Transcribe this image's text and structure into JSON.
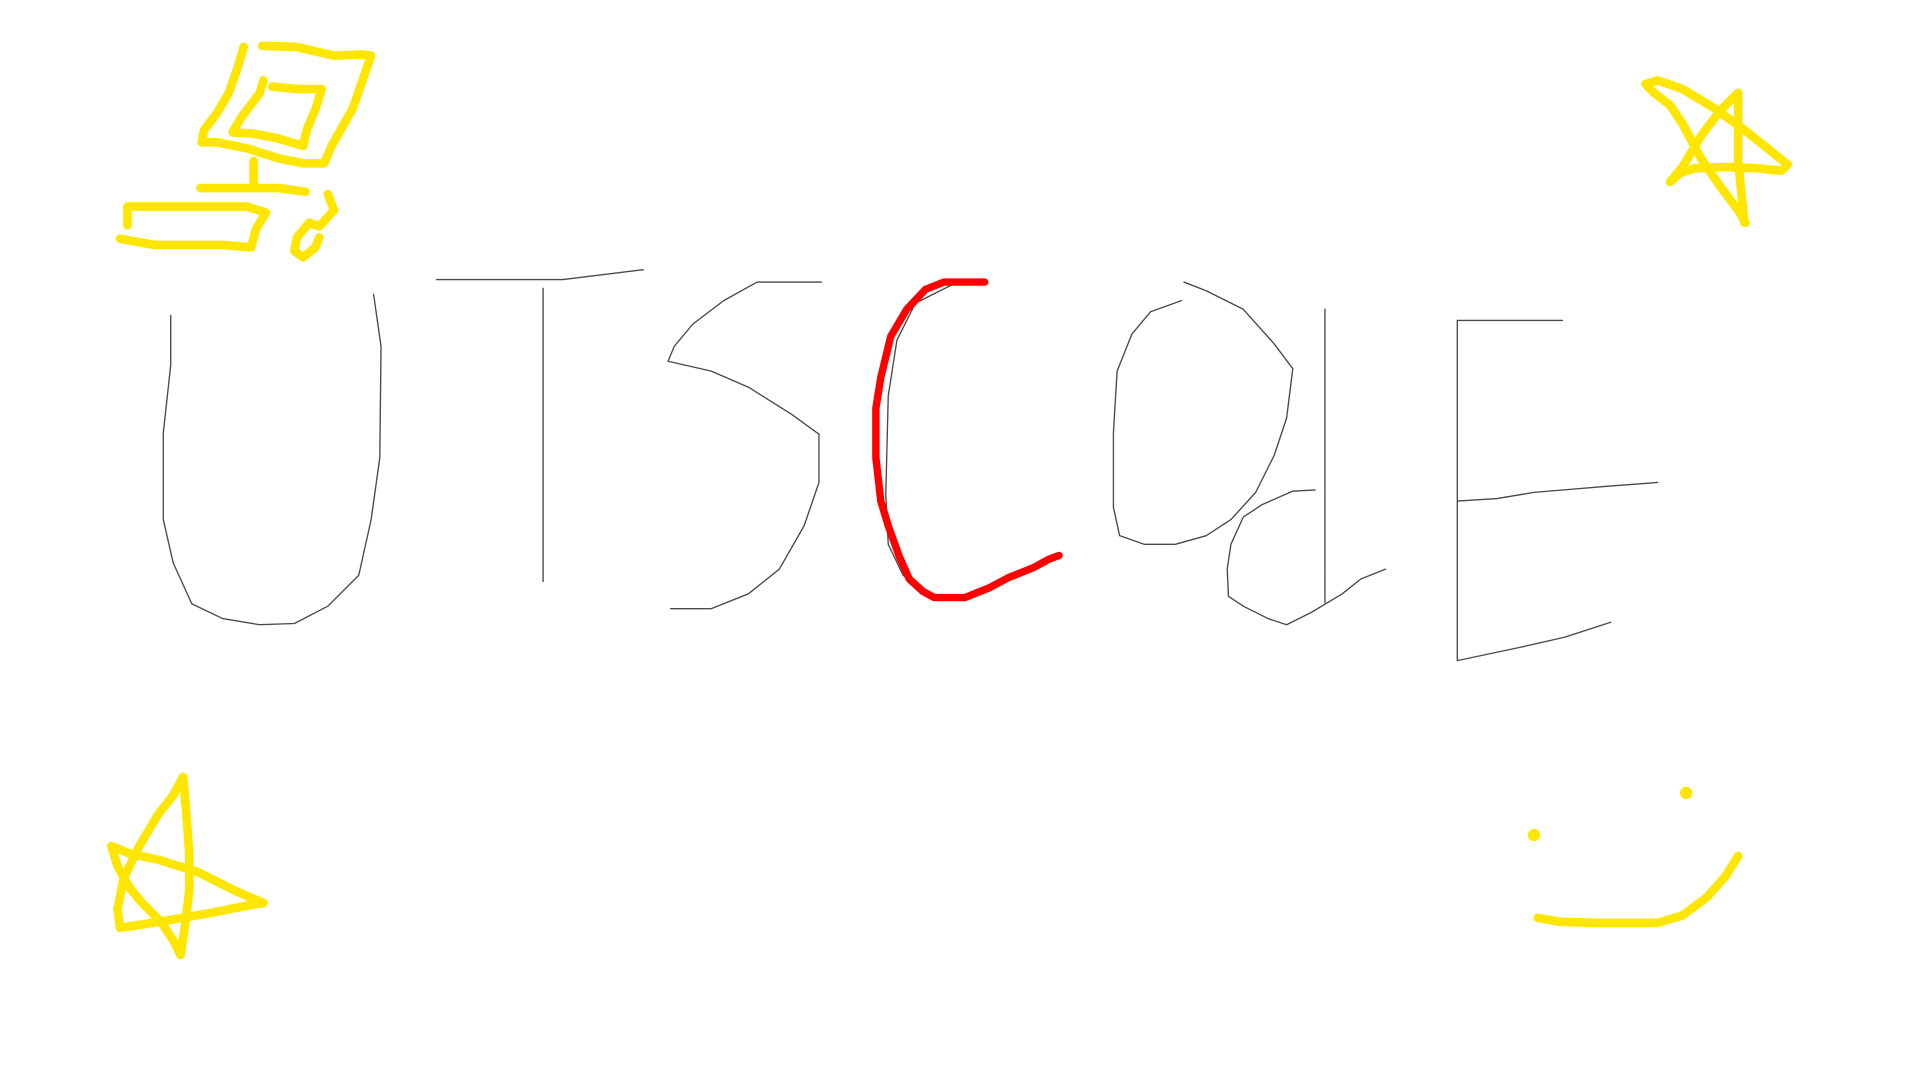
{
  "canvas": {
    "background": "#ffffff",
    "drawing_lettering": "UTSCodE"
  },
  "colors": {
    "pencil": "#4a4a4a",
    "highlight": "#ff0000",
    "doodle": "#ffe600"
  }
}
